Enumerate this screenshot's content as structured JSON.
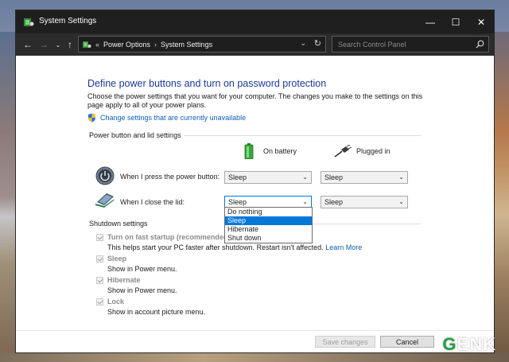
{
  "window": {
    "title": "System Settings",
    "controls": {
      "minimize": "—",
      "maximize": "☐",
      "close": "✕"
    }
  },
  "address": {
    "breadcrumb": [
      "Power Options",
      "System Settings"
    ],
    "search_placeholder": "Search Control Panel"
  },
  "page": {
    "heading": "Define power buttons and turn on password protection",
    "description": "Choose the power settings that you want for your computer. The changes you make to the settings on this page apply to all of your power plans.",
    "change_link": "Change settings that are currently unavailable"
  },
  "power_settings": {
    "group_label": "Power button and lid settings",
    "columns": {
      "battery": "On battery",
      "plugged": "Plugged in"
    },
    "rows": [
      {
        "label": "When I press the power button:",
        "battery": "Sleep",
        "plugged": "Sleep"
      },
      {
        "label": "When I close the lid:",
        "battery": "Sleep",
        "plugged": "Sleep"
      }
    ],
    "open_dropdown": {
      "options": [
        "Do nothing",
        "Sleep",
        "Hibernate",
        "Shut down"
      ],
      "selected": "Sleep"
    }
  },
  "shutdown_settings": {
    "group_label": "Shutdown settings",
    "items": [
      {
        "title": "Turn on fast startup (recommended)",
        "sub": "This helps start your PC faster after shutdown. Restart isn't affected.",
        "link": "Learn More",
        "checked": true
      },
      {
        "title": "Sleep",
        "sub": "Show in Power menu.",
        "checked": true
      },
      {
        "title": "Hibernate",
        "sub": "Show in Power menu.",
        "checked": true
      },
      {
        "title": "Lock",
        "sub": "Show in account picture menu.",
        "checked": true
      }
    ]
  },
  "buttons": {
    "save": "Save changes",
    "cancel": "Cancel"
  },
  "watermark": {
    "g": "G",
    "rest": "ENK"
  },
  "colors": {
    "heading": "#1b3b94",
    "link": "#0f5fb6",
    "selection": "#0078d7",
    "titlebar": "#1f1f1f"
  }
}
